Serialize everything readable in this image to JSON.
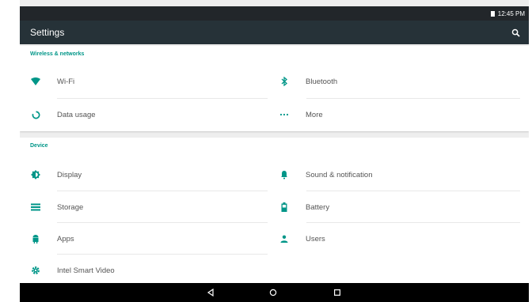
{
  "status_bar": {
    "time": "12:45 PM"
  },
  "app_bar": {
    "title": "Settings"
  },
  "sections": {
    "wireless": {
      "title": "Wireless & networks",
      "items": [
        "Wi-Fi",
        "Bluetooth",
        "Data usage",
        "More"
      ]
    },
    "device": {
      "title": "Device",
      "items": [
        "Display",
        "Sound & notification",
        "Storage",
        "Battery",
        "Apps",
        "Users",
        "Intel Smart Video"
      ]
    }
  },
  "colors": {
    "accent": "#009688",
    "appbar": "#263238",
    "statusbar": "#22262a"
  },
  "icons": {
    "wifi": "wifi-icon",
    "bluetooth": "bluetooth-icon",
    "data_usage": "data-usage-icon",
    "more": "more-dots-icon",
    "display": "display-brightness-icon",
    "sound": "bell-icon",
    "storage": "storage-list-icon",
    "battery": "battery-icon",
    "apps": "android-icon",
    "users": "user-icon",
    "intel_video": "gear-icon",
    "search": "search-icon"
  }
}
